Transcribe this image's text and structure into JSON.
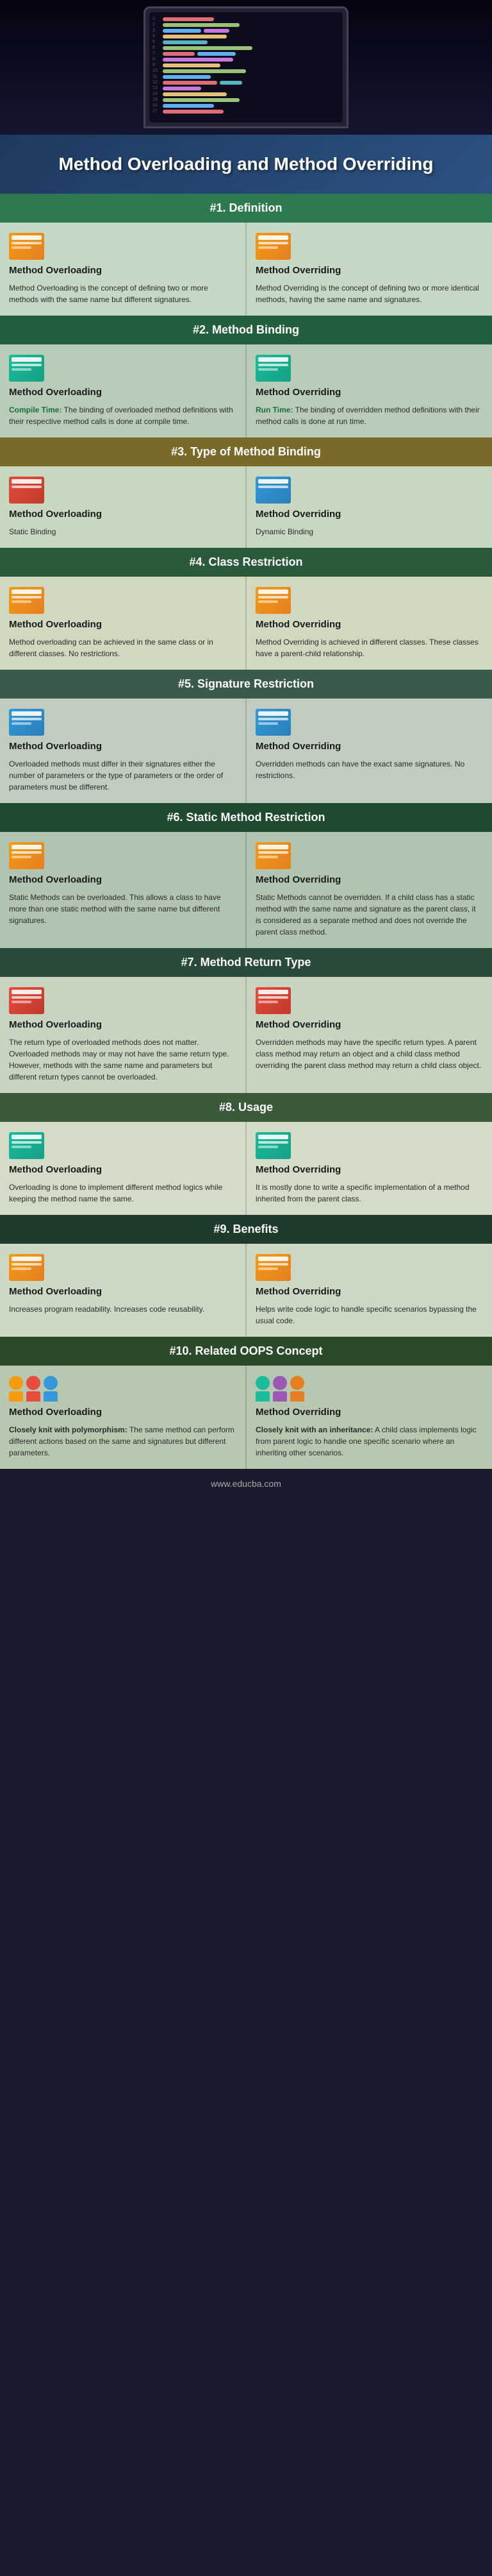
{
  "page": {
    "title": "Method Overloading and Method Overriding",
    "website": "www.educba.com"
  },
  "sections": [
    {
      "id": "s1",
      "header": "#1. Definition",
      "left_title": "Method Overloading",
      "right_title": "Method Overriding",
      "left_text": "Method Overloading is the concept of defining two or more methods with the same name but different signatures.",
      "right_text": "Method Overriding is the concept of defining two or more identical methods, having the same name and signatures.",
      "left_icon": "doc-orange",
      "right_icon": "doc-orange"
    },
    {
      "id": "s2",
      "header": "#2. Method Binding",
      "left_title": "Method Overloading",
      "right_title": "Method Overriding",
      "left_text": "Compile Time: The binding of overloaded method definitions with their respective method calls is done at compile time.",
      "right_text": "Run Time: The binding of overridden method definitions with their method calls is done at run time.",
      "left_highlight": "Compile Time:",
      "right_highlight": "Run Time:",
      "left_icon": "doc-teal",
      "right_icon": "doc-teal"
    },
    {
      "id": "s3",
      "header": "#3. Type of Method Binding",
      "left_title": "Method Overloading",
      "right_title": "Method Overriding",
      "left_text": "Static Binding",
      "right_text": "Dynamic Binding",
      "left_icon": "doc-red",
      "right_icon": "doc-blue"
    },
    {
      "id": "s4",
      "header": "#4. Class Restriction",
      "left_title": "Method Overloading",
      "right_title": "Method Overriding",
      "left_text": "Method overloading can be achieved in the same class or in different classes. No restrictions.",
      "right_text": "Method Overriding is achieved in different classes. These classes have a parent-child relationship.",
      "left_icon": "doc-orange",
      "right_icon": "doc-orange"
    },
    {
      "id": "s5",
      "header": "#5. Signature Restriction",
      "left_title": "Method Overloading",
      "right_title": "Method Overriding",
      "left_text": "Overloaded methods must differ in their signatures either the number of parameters or the type of parameters or the order of parameters must be different.",
      "right_text": "Overridden methods can have the exact same signatures. No restrictions.",
      "left_icon": "doc-blue",
      "right_icon": "doc-blue"
    },
    {
      "id": "s6",
      "header": "#6. Static Method Restriction",
      "left_title": "Method Overloading",
      "right_title": "Method Overriding",
      "left_text": "Static Methods can be overloaded. This allows a class to have more than one static method with the same name but different signatures.",
      "right_text": "Static Methods cannot be overridden. If a child class has a static method with the same name and signature as the parent class, it is considered as a separate method and does not override the parent class method.",
      "left_icon": "doc-orange",
      "right_icon": "doc-orange"
    },
    {
      "id": "s7",
      "header": "#7. Method Return Type",
      "left_title": "Method Overloading",
      "right_title": "Method Overriding",
      "left_text": "The return type of overloaded methods does not matter. Overloaded methods may or may not have the same return type. However, methods with the same name and parameters but different return types cannot be overloaded.",
      "right_text": "Overridden methods may have the specific return types. A parent class method may return an object and a child class method overriding the parent class method may return a child class object.",
      "left_icon": "doc-red",
      "right_icon": "doc-red"
    },
    {
      "id": "s8",
      "header": "#8. Usage",
      "left_title": "Method Overloading",
      "right_title": "Method Overriding",
      "left_text": "Overloading is done to implement different method logics while keeping the method name the same.",
      "right_text": "It is mostly done to write a specific implementation of a method inherited from the parent class.",
      "left_icon": "doc-teal",
      "right_icon": "doc-teal"
    },
    {
      "id": "s9",
      "header": "#9. Benefits",
      "left_title": "Method Overloading",
      "right_title": "Method Overriding",
      "left_text": "Increases program readability. Increases code reusability.",
      "right_text": "Helps write code logic to handle specific scenarios bypassing the usual code.",
      "left_icon": "doc-orange",
      "right_icon": "doc-orange"
    },
    {
      "id": "s10",
      "header": "#10. Related OOPS Concept",
      "left_title": "Method Overloading",
      "right_title": "Method Overriding",
      "left_text": "Closely knit with polymorphism: The same method can perform different actions based on the same and signatures but different parameters.",
      "right_text": "Closely knit with an inheritance: A child class implements logic from parent logic to handle one specific scenario where an inheriting other scenarios.",
      "left_icon": "people-icon",
      "right_icon": "people-icon"
    }
  ],
  "section_headers": {
    "s1": "#1. Definition",
    "s2": "#2. Method Binding",
    "s3": "#3. Type of Method Binding",
    "s4": "#4. Class Restriction",
    "s5": "#5. Signature Restriction",
    "s6": "#6. Static Method Restriction",
    "s7": "#7. Method Return Type",
    "s8": "#8. Usage",
    "s9": "#9. Benefits",
    "s10": "#10. Related OOPS Concept"
  }
}
